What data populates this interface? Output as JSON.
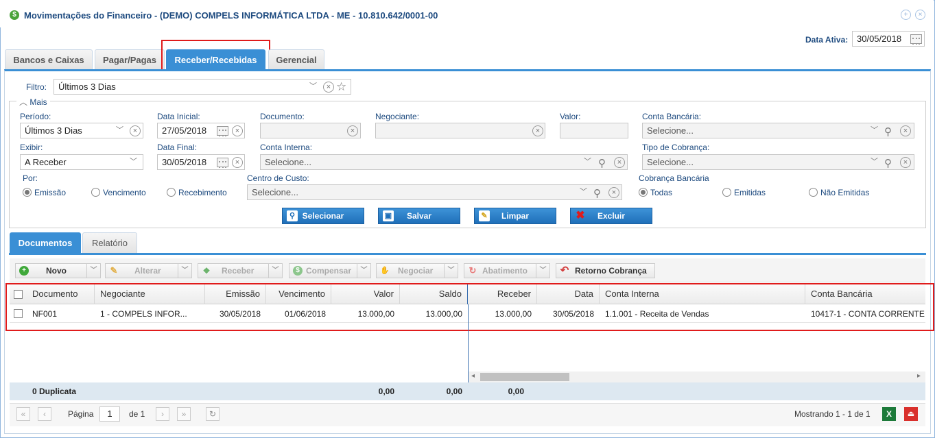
{
  "window": {
    "title": "Movimentações do Financeiro - (DEMO) COMPELS INFORMÁTICA LTDA - ME - 10.810.642/0001-00",
    "icon": "dollar-icon"
  },
  "data_ativa": {
    "label": "Data Ativa:",
    "value": "30/05/2018"
  },
  "tabs": [
    {
      "label": "Bancos e Caixas"
    },
    {
      "label": "Pagar/Pagas"
    },
    {
      "label": "Receber/Recebidas",
      "active": true
    },
    {
      "label": "Gerencial"
    }
  ],
  "filter": {
    "label": "Filtro:",
    "value": "Últimos 3 Dias"
  },
  "mais": {
    "label": "Mais",
    "periodo": {
      "label": "Período:",
      "value": "Últimos 3 Dias"
    },
    "data_inicial": {
      "label": "Data Inicial:",
      "value": "27/05/2018"
    },
    "documento": {
      "label": "Documento:",
      "value": ""
    },
    "negociante": {
      "label": "Negociante:",
      "value": ""
    },
    "valor": {
      "label": "Valor:",
      "value": ""
    },
    "conta_bancaria": {
      "label": "Conta Bancária:",
      "placeholder": "Selecione..."
    },
    "exibir": {
      "label": "Exibir:",
      "value": "A Receber"
    },
    "data_final": {
      "label": "Data Final:",
      "value": "30/05/2018"
    },
    "conta_interna": {
      "label": "Conta Interna:",
      "placeholder": "Selecione..."
    },
    "tipo_cobranca": {
      "label": "Tipo de Cobrança:",
      "placeholder": "Selecione..."
    },
    "por": {
      "label": "Por:",
      "options": [
        "Emissão",
        "Vencimento",
        "Recebimento"
      ],
      "selected": "Emissão"
    },
    "centro_custo": {
      "label": "Centro de Custo:",
      "placeholder": "Selecione..."
    },
    "cobranca_bancaria": {
      "label": "Cobrança Bancária",
      "options": [
        "Todas",
        "Emitidas",
        "Não Emitidas"
      ],
      "selected": "Todas"
    }
  },
  "actions": {
    "selecionar": "Selecionar",
    "salvar": "Salvar",
    "limpar": "Limpar",
    "excluir": "Excluir"
  },
  "subtabs": [
    {
      "label": "Documentos",
      "active": true
    },
    {
      "label": "Relatório"
    }
  ],
  "toolbar": {
    "novo": "Novo",
    "alterar": "Alterar",
    "receber": "Receber",
    "compensar": "Compensar",
    "negociar": "Negociar",
    "abatimento": "Abatimento",
    "retorno": "Retorno Cobrança"
  },
  "grid": {
    "columns": [
      "Documento",
      "Negociante",
      "Emissão",
      "Vencimento",
      "Valor",
      "Saldo",
      "Receber",
      "Data",
      "Conta Interna",
      "Conta Bancária"
    ],
    "rows": [
      {
        "documento": "NF001",
        "negociante": "1 - COMPELS INFOR...",
        "emissao": "30/05/2018",
        "vencimento": "01/06/2018",
        "valor": "13.000,00",
        "saldo": "13.000,00",
        "receber": "13.000,00",
        "data": "30/05/2018",
        "conta_interna": "1.1.001 - Receita de Vendas",
        "conta_bancaria": "10417-1 - CONTA CORRENTE"
      }
    ],
    "footer": {
      "count": "0 Duplicata",
      "valor": "0,00",
      "saldo": "0,00",
      "receber": "0,00"
    }
  },
  "pager": {
    "page_label": "Página",
    "page": "1",
    "of": "de 1",
    "summary": "Mostrando 1 - 1 de 1"
  },
  "colors": {
    "accent": "#3a8fd5",
    "highlight": "#e01b1b",
    "label": "#1d4a7f"
  }
}
